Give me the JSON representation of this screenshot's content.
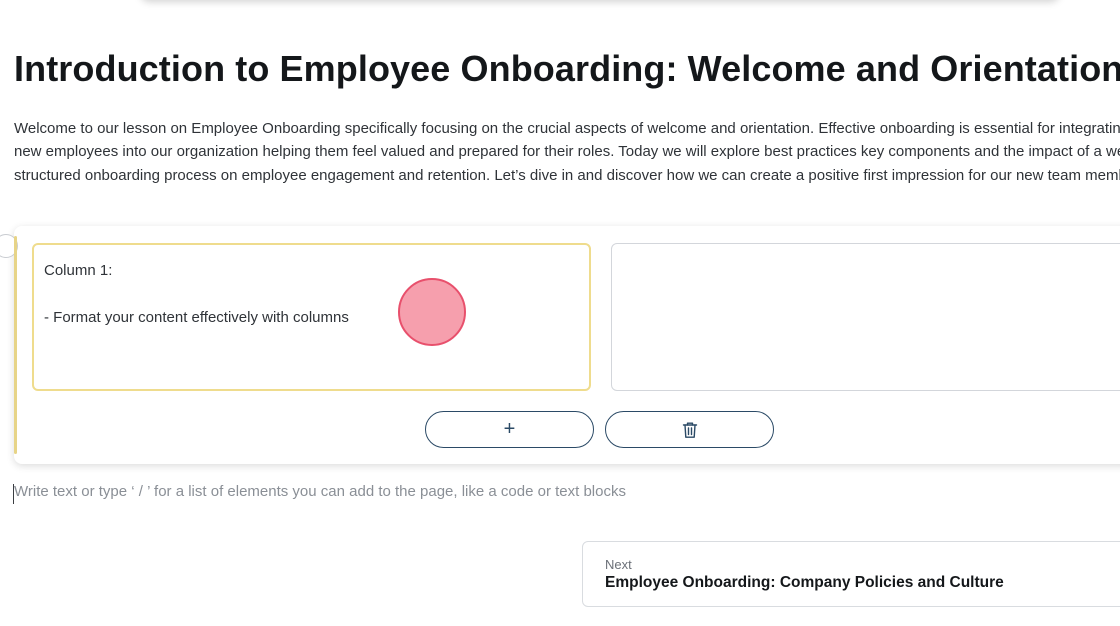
{
  "lesson": {
    "title": "Introduction to Employee Onboarding: Welcome and Orientation",
    "intro": "Welcome to our lesson on Employee Onboarding specifically focusing on the crucial aspects of welcome and orientation. Effective onboarding is essential for integrating new employees into our organization helping them feel valued and prepared for their roles. Today we will explore best practices key components and the impact of a well-structured onboarding process on employee engagement and retention. Let’s dive in and discover how we can create a positive first impression for our new team members!"
  },
  "columns_block": {
    "column_1": {
      "heading": "Column 1:",
      "line": "- Format your content effectively with columns"
    },
    "column_2": {
      "text": ""
    },
    "add_button_icon": "plus-icon",
    "add_button_label": "+",
    "delete_button_icon": "trash-icon"
  },
  "editor": {
    "placeholder": "Write text or type ‘ / ’ for a list of elements you can add to the page, like a code or text blocks"
  },
  "next": {
    "label": "Next",
    "title": "Employee Onboarding: Company Policies and Culture"
  },
  "colors": {
    "accent_yellow": "#efdc8d",
    "button_border": "#2b4a66",
    "click_marker": "#f48496"
  }
}
